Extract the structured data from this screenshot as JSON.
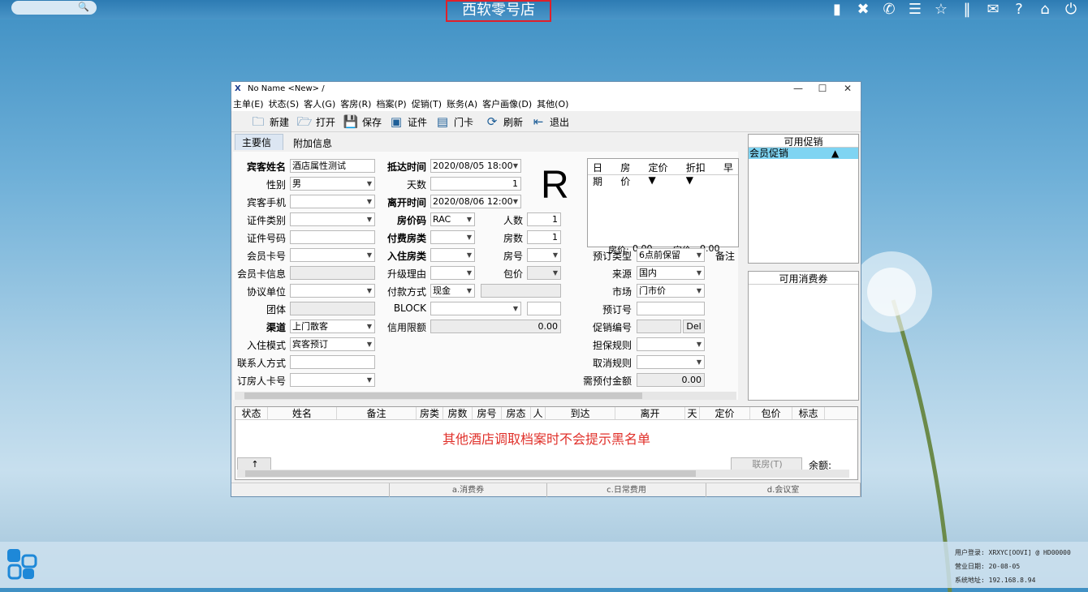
{
  "topbar": {
    "search_placeholder": "",
    "store_title": "西软零号店",
    "icons": [
      "signal-icon",
      "tools-icon",
      "phone-icon",
      "menu-icon",
      "star-icon",
      "bars-icon",
      "mail-icon",
      "help-icon",
      "home-icon",
      "power-icon"
    ]
  },
  "window": {
    "title": "No Name <New> /",
    "menu": [
      "主单(E)",
      "状态(S)",
      "客人(G)",
      "客房(R)",
      "档案(P)",
      "促销(T)",
      "账务(A)",
      "客户画像(D)",
      "其他(O)"
    ],
    "toolbar": {
      "new": "新建",
      "open": "打开",
      "save": "保存",
      "id": "证件",
      "card": "门卡",
      "refresh": "刷新",
      "exit": "退出"
    },
    "tabs": {
      "main": "主要信息",
      "extra": "附加信息"
    }
  },
  "form": {
    "guest_name_label": "宾客姓名",
    "guest_name": "酒店属性测试",
    "gender_label": "性别",
    "gender": "男",
    "mobile_label": "宾客手机",
    "mobile": "",
    "id_type_label": "证件类别",
    "id_type": "",
    "id_no_label": "证件号码",
    "id_no": "",
    "member_card_label": "会员卡号",
    "member_card": "",
    "member_info_label": "会员卡信息",
    "member_info": "",
    "agreement_label": "协议单位",
    "agreement": "",
    "group_label": "团体",
    "group": "",
    "channel_label": "渠道",
    "channel": "上门散客",
    "checkin_mode_label": "入住模式",
    "checkin_mode": "宾客预订",
    "contact_label": "联系人方式",
    "contact": "",
    "booker_card_label": "订房人卡号",
    "booker_card": "",
    "arrive_label": "抵达时间",
    "arrive": "2020/08/05 18:00",
    "days_label": "天数",
    "days": "1",
    "depart_label": "离开时间",
    "depart": "2020/08/06 12:00",
    "rate_code_label": "房价码",
    "rate_code": "RAC",
    "persons_label": "人数",
    "persons": "1",
    "paid_type_label": "付费房类",
    "paid_type": "",
    "rooms_label": "房数",
    "rooms": "1",
    "room_type_label": "入住房类",
    "room_type": "",
    "room_no_label": "房号",
    "room_no": "",
    "upgrade_label": "升级理由",
    "upgrade": "",
    "package_label": "包价",
    "package": "",
    "pay_label": "付款方式",
    "pay": "现金",
    "pay_extra": "",
    "block_label": "BLOCK",
    "block": "",
    "block_extra": "",
    "credit_label": "信用限额",
    "credit": "0.00",
    "status_letter": "R",
    "book_type_label": "预订类型",
    "book_type": "6点前保留",
    "remark_label": "备注",
    "source_label": "来源",
    "source": "国内",
    "market_label": "市场",
    "market": "门市价",
    "booking_no_label": "预订号",
    "booking_no": "",
    "promo_no_label": "促销编号",
    "promo_no": "",
    "del_btn": "Del",
    "guarantee_label": "担保规则",
    "guarantee": "",
    "cancel_label": "取消规则",
    "cancel": "",
    "prepay_label": "需预付金额",
    "prepay": "0.00"
  },
  "rate_grid": {
    "headers": [
      "日期",
      "房价",
      "定价 ▼",
      "折扣 ▼",
      "早"
    ],
    "room_rate_label": "房价:",
    "room_rate": "0.00",
    "list_rate_label": "定价:",
    "list_rate": "0.00"
  },
  "side": {
    "promo_title": "可用促销",
    "promo_item": "会员促销",
    "promo_mark": "▲",
    "coupon_title": "可用消费券"
  },
  "list": {
    "headers": [
      "状态",
      "姓名",
      "备注",
      "房类",
      "房数",
      "房号",
      "房态",
      "人",
      "到达",
      "离开",
      "天",
      "定价",
      "包价",
      "标志"
    ],
    "notice": "其他酒店调取档案时不会提示黑名单",
    "arrow": "↑",
    "join_btn": "联房(T)",
    "balance_label": "余额:"
  },
  "statusbar": [
    "",
    "a.消费券",
    "c.日常费用",
    "d.会议室"
  ],
  "sysinfo": {
    "login": "用户登录: XRXYC[OOVI] @ HD00000",
    "date": "营业日期: 20-08-05",
    "ip": "系统地址: 192.168.8.94"
  }
}
